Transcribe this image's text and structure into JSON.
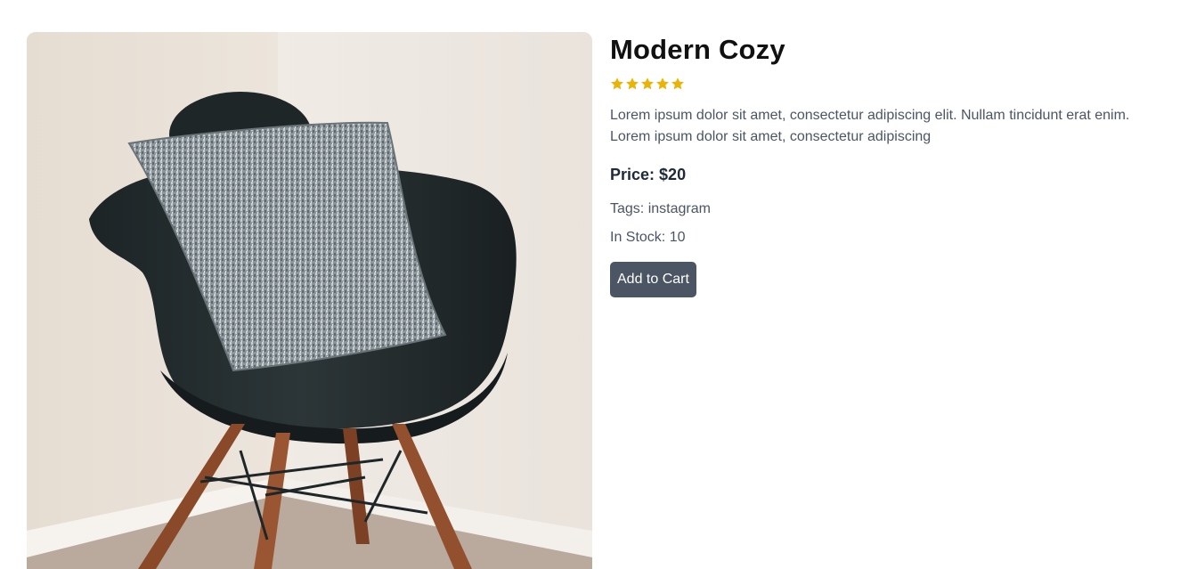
{
  "product": {
    "image_alt": "Black armchair with grey cushion in room corner",
    "title": "Modern Cozy",
    "rating": 5,
    "rating_max": 5,
    "star_color": "#eab308",
    "description": "Lorem ipsum dolor sit amet, consectetur adipiscing elit. Nullam tincidunt erat enim. Lorem ipsum dolor sit amet, consectetur adipiscing",
    "price_label": "Price:",
    "price_value": "$20",
    "tags_label": "Tags:",
    "tags_value": "instagram",
    "stock_label": "In Stock:",
    "stock_value": "10",
    "add_to_cart_label": "Add to Cart",
    "button_color": "#4b5563"
  }
}
